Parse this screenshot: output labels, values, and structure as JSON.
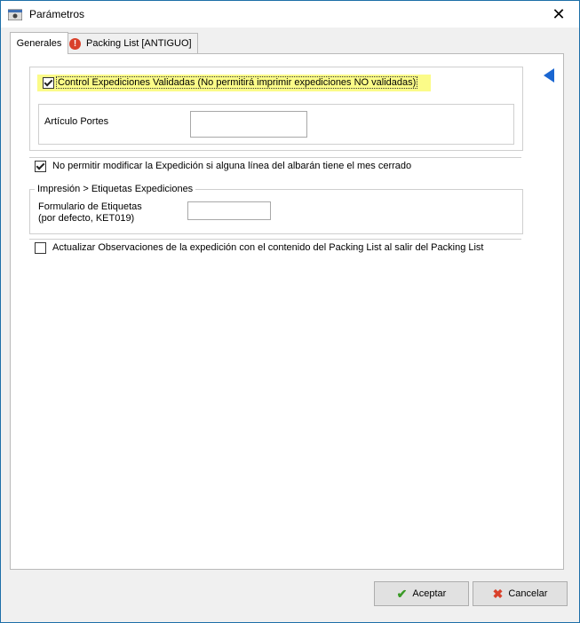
{
  "window": {
    "title": "Parámetros",
    "close_glyph": "✕"
  },
  "tabs": [
    {
      "label": "Generales",
      "active": true
    },
    {
      "label": "Packing List [ANTIGUO]",
      "active": false,
      "icon": "warning-icon"
    }
  ],
  "generales": {
    "control_validadas": {
      "label": "Control Expediciones Validadas (No permitirá imprimir expediciones NO validadas)",
      "checked": true
    },
    "articulo_portes": {
      "label": "Artículo Portes",
      "value": ""
    },
    "no_modificar": {
      "label": "No permitir modificar la Expedición si alguna línea del albarán tiene el mes cerrado",
      "checked": true
    },
    "etiquetas_group_title": "Impresión > Etiquetas Expediciones",
    "formulario_label_line1": "Formulario de Etiquetas",
    "formulario_label_line2": "(por defecto, KET019)",
    "formulario_value": "",
    "actualizar_obs": {
      "label": "Actualizar Observaciones de la expedición con el contenido del Packing List al salir del Packing List",
      "checked": false
    }
  },
  "buttons": {
    "accept_label": "Aceptar",
    "cancel_label": "Cancelar"
  },
  "colors": {
    "highlight": "#fbfb88",
    "accent_arrow": "#1a66d1",
    "accept_icon": "#3a9a26",
    "cancel_icon": "#d9412b"
  }
}
